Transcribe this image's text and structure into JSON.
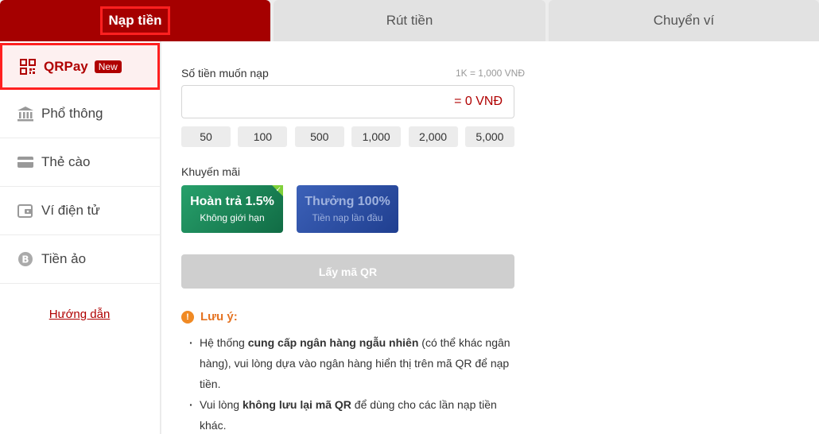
{
  "tabs": {
    "deposit": "Nạp tiền",
    "withdraw": "Rút tiền",
    "transfer": "Chuyển ví"
  },
  "sidebar": {
    "items": [
      {
        "label": "QRPay",
        "badge": "New",
        "icon": "qr-code-icon"
      },
      {
        "label": "Phổ thông",
        "icon": "bank-icon"
      },
      {
        "label": "Thẻ cào",
        "icon": "card-icon"
      },
      {
        "label": "Ví điện tử",
        "icon": "wallet-icon"
      },
      {
        "label": "Tiền ảo",
        "icon": "bitcoin-icon"
      }
    ],
    "guide": "Hướng dẫn"
  },
  "form": {
    "amount_label": "Số tiền muốn nạp",
    "rate_note": "1K = 1,000 VNĐ",
    "amount_value": "= 0 VNĐ",
    "chips": [
      "50",
      "100",
      "500",
      "1,000",
      "2,000",
      "5,000"
    ],
    "promo_label": "Khuyến mãi",
    "promos": [
      {
        "title": "Hoàn trả 1.5%",
        "subtitle": "Không giới hạn"
      },
      {
        "title": "Thưởng 100%",
        "subtitle": "Tiền nạp lần đầu"
      }
    ],
    "submit": "Lấy mã QR"
  },
  "notes": {
    "title": "Lưu ý:",
    "items": [
      {
        "pre": "Hệ thống ",
        "bold": "cung cấp ngân hàng ngẫu nhiên",
        "post": " (có thể khác ngân hàng), vui lòng dựa vào ngân hàng hiển thị trên mã QR để nạp tiền."
      },
      {
        "pre": "Vui lòng ",
        "bold": "không lưu lại mã QR",
        "post": " để dùng cho các lần nạp tiền khác."
      }
    ]
  },
  "colors": {
    "brand": "#a50000",
    "accent": "#b00000",
    "promo_green": "#1e8a5a",
    "promo_blue": "#2d4fa3"
  }
}
